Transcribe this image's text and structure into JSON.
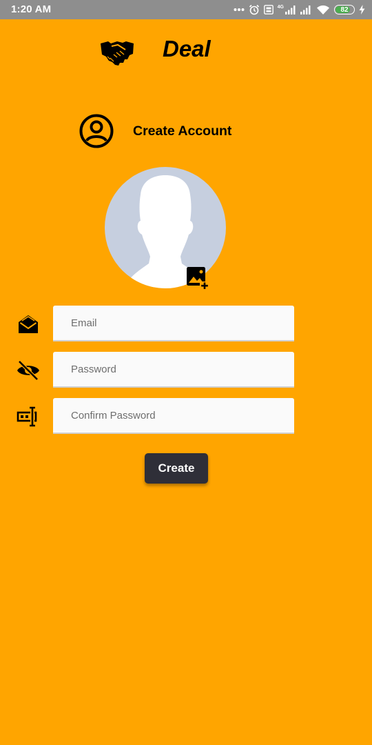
{
  "status_bar": {
    "time": "1:20 AM",
    "network_label": "4G",
    "battery": "82",
    "battery_level": 0.82,
    "icons": [
      "more-dots-icon",
      "alarm-icon",
      "volte-icon",
      "signal-4g-icon",
      "signal-icon",
      "wifi-icon",
      "battery-icon",
      "charging-icon"
    ]
  },
  "brand": {
    "title": "Deal",
    "icon": "handshake-icon"
  },
  "section": {
    "title": "Create Account",
    "icon": "account-circle-icon"
  },
  "avatar": {
    "icon": "person-silhouette",
    "add_icon": "add-photo-icon"
  },
  "form": {
    "email": {
      "placeholder": "Email",
      "value": "",
      "icon": "mail-open-icon"
    },
    "password": {
      "placeholder": "Password",
      "value": "",
      "icon": "visibility-off-icon"
    },
    "confirm_password": {
      "placeholder": "Confirm Password",
      "value": "",
      "icon": "password-input-icon"
    },
    "submit_label": "Create"
  },
  "colors": {
    "background": "#FFA500",
    "status_bar": "#8E8E8E",
    "input_background": "#FAFAFA",
    "button_background": "#2F2F38",
    "button_text": "#FFFFFF",
    "avatar_background": "#C6CFDF",
    "battery_fill": "#4CAF50"
  }
}
